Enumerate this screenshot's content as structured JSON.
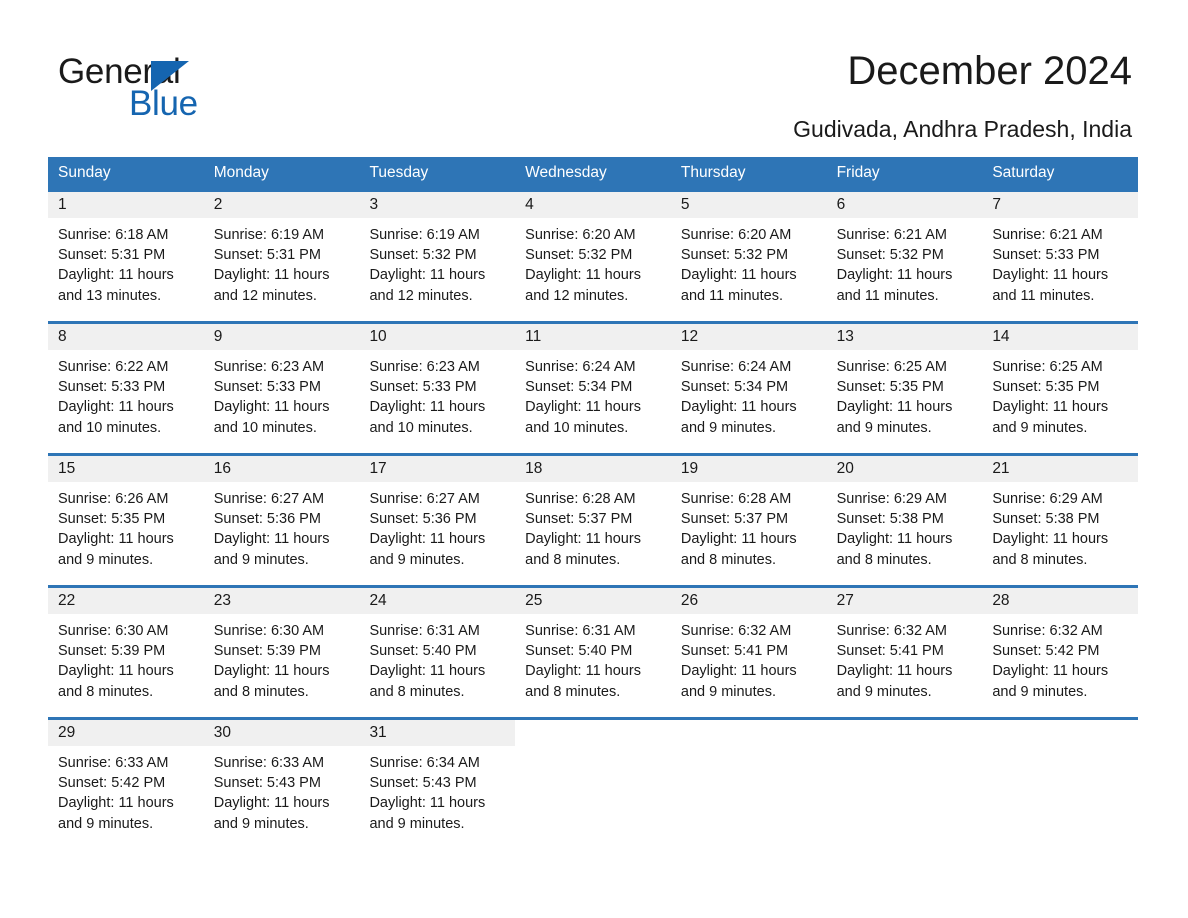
{
  "brand": {
    "name_part1": "General",
    "name_part2": "Blue",
    "triangle_color": "#1565B0",
    "accent_color": "#2E75B6"
  },
  "header": {
    "title": "December 2024",
    "location": "Gudivada, Andhra Pradesh, India"
  },
  "calendar": {
    "weekdays": [
      "Sunday",
      "Monday",
      "Tuesday",
      "Wednesday",
      "Thursday",
      "Friday",
      "Saturday"
    ],
    "header_bg": "#2E75B6",
    "daynum_bg": "#F0F0F0",
    "weeks": [
      {
        "days": [
          {
            "date": "1",
            "sunrise": "Sunrise: 6:18 AM",
            "sunset": "Sunset: 5:31 PM",
            "daylight1": "Daylight: 11 hours",
            "daylight2": "and 13 minutes."
          },
          {
            "date": "2",
            "sunrise": "Sunrise: 6:19 AM",
            "sunset": "Sunset: 5:31 PM",
            "daylight1": "Daylight: 11 hours",
            "daylight2": "and 12 minutes."
          },
          {
            "date": "3",
            "sunrise": "Sunrise: 6:19 AM",
            "sunset": "Sunset: 5:32 PM",
            "daylight1": "Daylight: 11 hours",
            "daylight2": "and 12 minutes."
          },
          {
            "date": "4",
            "sunrise": "Sunrise: 6:20 AM",
            "sunset": "Sunset: 5:32 PM",
            "daylight1": "Daylight: 11 hours",
            "daylight2": "and 12 minutes."
          },
          {
            "date": "5",
            "sunrise": "Sunrise: 6:20 AM",
            "sunset": "Sunset: 5:32 PM",
            "daylight1": "Daylight: 11 hours",
            "daylight2": "and 11 minutes."
          },
          {
            "date": "6",
            "sunrise": "Sunrise: 6:21 AM",
            "sunset": "Sunset: 5:32 PM",
            "daylight1": "Daylight: 11 hours",
            "daylight2": "and 11 minutes."
          },
          {
            "date": "7",
            "sunrise": "Sunrise: 6:21 AM",
            "sunset": "Sunset: 5:33 PM",
            "daylight1": "Daylight: 11 hours",
            "daylight2": "and 11 minutes."
          }
        ]
      },
      {
        "days": [
          {
            "date": "8",
            "sunrise": "Sunrise: 6:22 AM",
            "sunset": "Sunset: 5:33 PM",
            "daylight1": "Daylight: 11 hours",
            "daylight2": "and 10 minutes."
          },
          {
            "date": "9",
            "sunrise": "Sunrise: 6:23 AM",
            "sunset": "Sunset: 5:33 PM",
            "daylight1": "Daylight: 11 hours",
            "daylight2": "and 10 minutes."
          },
          {
            "date": "10",
            "sunrise": "Sunrise: 6:23 AM",
            "sunset": "Sunset: 5:33 PM",
            "daylight1": "Daylight: 11 hours",
            "daylight2": "and 10 minutes."
          },
          {
            "date": "11",
            "sunrise": "Sunrise: 6:24 AM",
            "sunset": "Sunset: 5:34 PM",
            "daylight1": "Daylight: 11 hours",
            "daylight2": "and 10 minutes."
          },
          {
            "date": "12",
            "sunrise": "Sunrise: 6:24 AM",
            "sunset": "Sunset: 5:34 PM",
            "daylight1": "Daylight: 11 hours",
            "daylight2": "and 9 minutes."
          },
          {
            "date": "13",
            "sunrise": "Sunrise: 6:25 AM",
            "sunset": "Sunset: 5:35 PM",
            "daylight1": "Daylight: 11 hours",
            "daylight2": "and 9 minutes."
          },
          {
            "date": "14",
            "sunrise": "Sunrise: 6:25 AM",
            "sunset": "Sunset: 5:35 PM",
            "daylight1": "Daylight: 11 hours",
            "daylight2": "and 9 minutes."
          }
        ]
      },
      {
        "days": [
          {
            "date": "15",
            "sunrise": "Sunrise: 6:26 AM",
            "sunset": "Sunset: 5:35 PM",
            "daylight1": "Daylight: 11 hours",
            "daylight2": "and 9 minutes."
          },
          {
            "date": "16",
            "sunrise": "Sunrise: 6:27 AM",
            "sunset": "Sunset: 5:36 PM",
            "daylight1": "Daylight: 11 hours",
            "daylight2": "and 9 minutes."
          },
          {
            "date": "17",
            "sunrise": "Sunrise: 6:27 AM",
            "sunset": "Sunset: 5:36 PM",
            "daylight1": "Daylight: 11 hours",
            "daylight2": "and 9 minutes."
          },
          {
            "date": "18",
            "sunrise": "Sunrise: 6:28 AM",
            "sunset": "Sunset: 5:37 PM",
            "daylight1": "Daylight: 11 hours",
            "daylight2": "and 8 minutes."
          },
          {
            "date": "19",
            "sunrise": "Sunrise: 6:28 AM",
            "sunset": "Sunset: 5:37 PM",
            "daylight1": "Daylight: 11 hours",
            "daylight2": "and 8 minutes."
          },
          {
            "date": "20",
            "sunrise": "Sunrise: 6:29 AM",
            "sunset": "Sunset: 5:38 PM",
            "daylight1": "Daylight: 11 hours",
            "daylight2": "and 8 minutes."
          },
          {
            "date": "21",
            "sunrise": "Sunrise: 6:29 AM",
            "sunset": "Sunset: 5:38 PM",
            "daylight1": "Daylight: 11 hours",
            "daylight2": "and 8 minutes."
          }
        ]
      },
      {
        "days": [
          {
            "date": "22",
            "sunrise": "Sunrise: 6:30 AM",
            "sunset": "Sunset: 5:39 PM",
            "daylight1": "Daylight: 11 hours",
            "daylight2": "and 8 minutes."
          },
          {
            "date": "23",
            "sunrise": "Sunrise: 6:30 AM",
            "sunset": "Sunset: 5:39 PM",
            "daylight1": "Daylight: 11 hours",
            "daylight2": "and 8 minutes."
          },
          {
            "date": "24",
            "sunrise": "Sunrise: 6:31 AM",
            "sunset": "Sunset: 5:40 PM",
            "daylight1": "Daylight: 11 hours",
            "daylight2": "and 8 minutes."
          },
          {
            "date": "25",
            "sunrise": "Sunrise: 6:31 AM",
            "sunset": "Sunset: 5:40 PM",
            "daylight1": "Daylight: 11 hours",
            "daylight2": "and 8 minutes."
          },
          {
            "date": "26",
            "sunrise": "Sunrise: 6:32 AM",
            "sunset": "Sunset: 5:41 PM",
            "daylight1": "Daylight: 11 hours",
            "daylight2": "and 9 minutes."
          },
          {
            "date": "27",
            "sunrise": "Sunrise: 6:32 AM",
            "sunset": "Sunset: 5:41 PM",
            "daylight1": "Daylight: 11 hours",
            "daylight2": "and 9 minutes."
          },
          {
            "date": "28",
            "sunrise": "Sunrise: 6:32 AM",
            "sunset": "Sunset: 5:42 PM",
            "daylight1": "Daylight: 11 hours",
            "daylight2": "and 9 minutes."
          }
        ]
      },
      {
        "days": [
          {
            "date": "29",
            "sunrise": "Sunrise: 6:33 AM",
            "sunset": "Sunset: 5:42 PM",
            "daylight1": "Daylight: 11 hours",
            "daylight2": "and 9 minutes."
          },
          {
            "date": "30",
            "sunrise": "Sunrise: 6:33 AM",
            "sunset": "Sunset: 5:43 PM",
            "daylight1": "Daylight: 11 hours",
            "daylight2": "and 9 minutes."
          },
          {
            "date": "31",
            "sunrise": "Sunrise: 6:34 AM",
            "sunset": "Sunset: 5:43 PM",
            "daylight1": "Daylight: 11 hours",
            "daylight2": "and 9 minutes."
          },
          {
            "date": "",
            "sunrise": "",
            "sunset": "",
            "daylight1": "",
            "daylight2": ""
          },
          {
            "date": "",
            "sunrise": "",
            "sunset": "",
            "daylight1": "",
            "daylight2": ""
          },
          {
            "date": "",
            "sunrise": "",
            "sunset": "",
            "daylight1": "",
            "daylight2": ""
          },
          {
            "date": "",
            "sunrise": "",
            "sunset": "",
            "daylight1": "",
            "daylight2": ""
          }
        ]
      }
    ]
  }
}
